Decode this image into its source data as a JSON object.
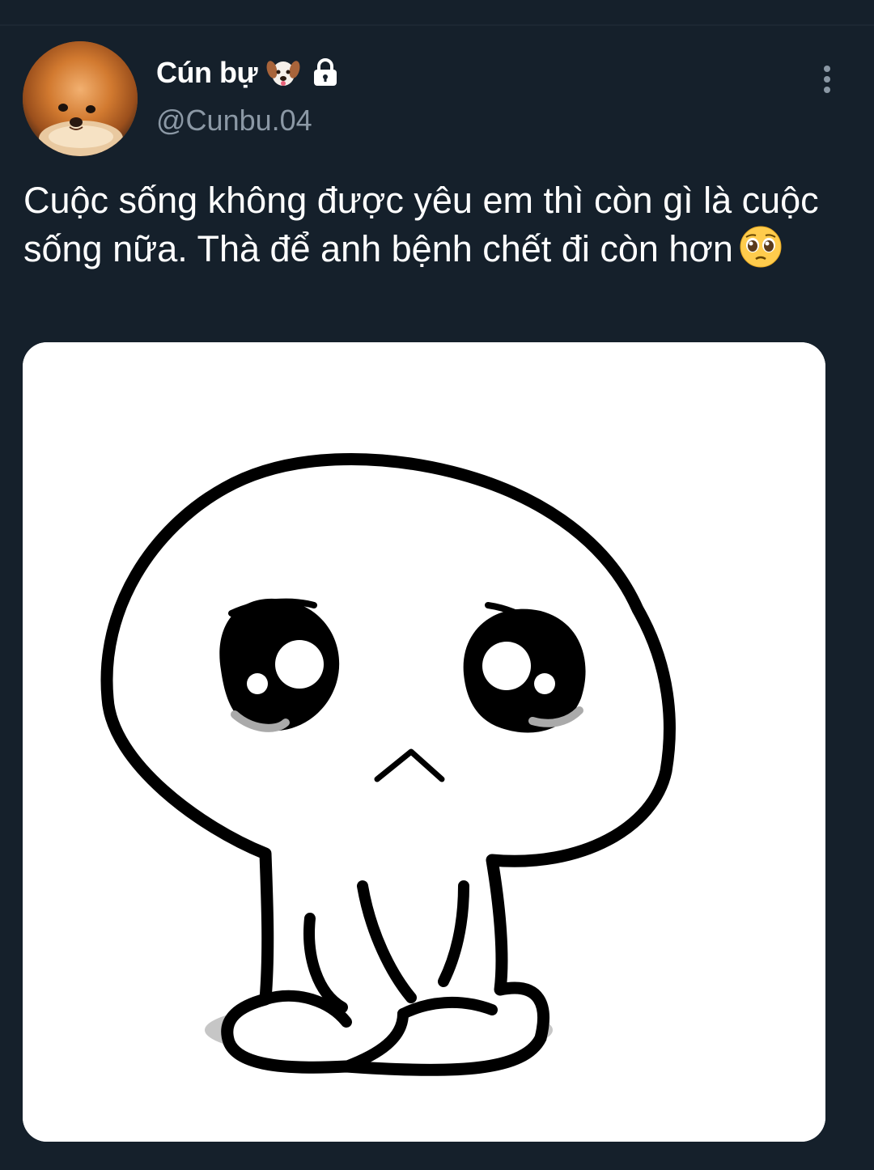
{
  "tweet": {
    "display_name": "Cún bự",
    "display_name_emoji": "dog-face-emoji",
    "protected_icon": "lock-icon",
    "handle": "@Cunbu.04",
    "text": "Cuộc sống không được yêu em thì còn gì là cuộc sống nữa. Thà để anh bệnh chết đi còn hơn",
    "text_emoji": "pleading-face-emoji",
    "media": {
      "icon": "sad-cartoon-character-image"
    },
    "more_icon": "more-options-icon"
  },
  "colors": {
    "background": "#15202b",
    "primary_text": "#ffffff",
    "secondary_text": "#8b98a5",
    "media_background": "#ffffff"
  }
}
